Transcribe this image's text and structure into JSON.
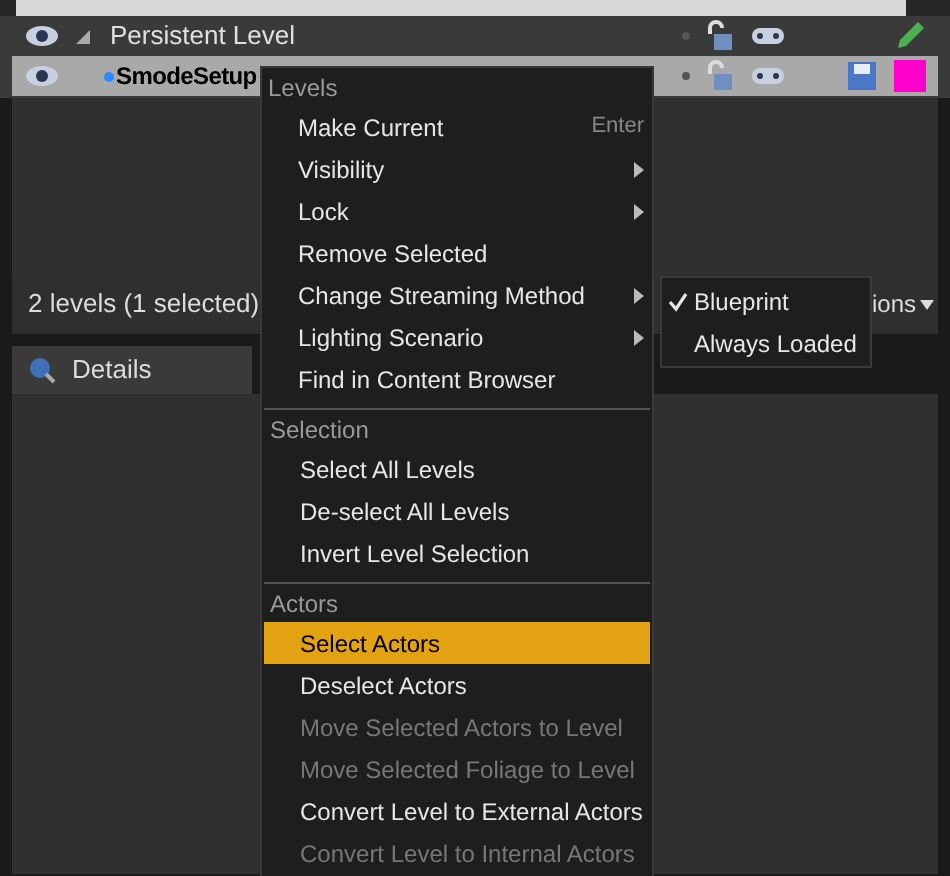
{
  "levels": [
    {
      "name": "Persistent Level",
      "selected": false,
      "kind": "persistent"
    },
    {
      "name": "SmodeSetup",
      "selected": true,
      "kind": "sublevel",
      "color": "#ff00cc"
    }
  ],
  "status_bar": {
    "count": "2 levels (1 selected)",
    "options": "ions"
  },
  "details_tab": {
    "label": "Details"
  },
  "context_menu": {
    "sections": [
      {
        "title": "Levels",
        "items": [
          {
            "label": "Make Current",
            "shortcut": "Enter",
            "submenu": false,
            "disabled": false,
            "selected": false
          },
          {
            "label": "Visibility",
            "submenu": true,
            "disabled": false,
            "selected": false
          },
          {
            "label": "Lock",
            "submenu": true,
            "disabled": false,
            "selected": false
          },
          {
            "label": "Remove Selected",
            "submenu": false,
            "disabled": false,
            "selected": false
          },
          {
            "label": "Change Streaming Method",
            "submenu": true,
            "disabled": false,
            "selected": false
          },
          {
            "label": "Lighting Scenario",
            "submenu": true,
            "disabled": false,
            "selected": false
          },
          {
            "label": "Find in Content Browser",
            "submenu": false,
            "disabled": false,
            "selected": false
          }
        ]
      },
      {
        "title": "Selection",
        "items": [
          {
            "label": "Select All Levels",
            "submenu": false,
            "disabled": false,
            "selected": false
          },
          {
            "label": "De-select All Levels",
            "submenu": false,
            "disabled": false,
            "selected": false
          },
          {
            "label": "Invert Level Selection",
            "submenu": false,
            "disabled": false,
            "selected": false
          }
        ]
      },
      {
        "title": "Actors",
        "items": [
          {
            "label": "Select Actors",
            "submenu": false,
            "disabled": false,
            "selected": true
          },
          {
            "label": "Deselect Actors",
            "submenu": false,
            "disabled": false,
            "selected": false
          },
          {
            "label": "Move Selected Actors to Level",
            "submenu": false,
            "disabled": true,
            "selected": false
          },
          {
            "label": "Move Selected Foliage to Level",
            "submenu": false,
            "disabled": true,
            "selected": false
          },
          {
            "label": "Convert Level to External Actors",
            "submenu": false,
            "disabled": false,
            "selected": false
          },
          {
            "label": "Convert Level to Internal Actors",
            "submenu": false,
            "disabled": true,
            "selected": false
          }
        ]
      }
    ]
  },
  "submenu": {
    "items": [
      {
        "label": "Blueprint",
        "checked": true
      },
      {
        "label": "Always Loaded",
        "checked": false
      }
    ]
  }
}
